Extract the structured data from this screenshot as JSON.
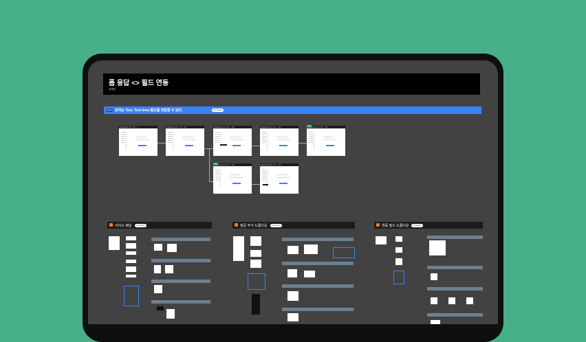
{
  "page": {
    "title": "폼 응답 <> 필드 연동",
    "author": "김태현"
  },
  "banner": {
    "tag": "Done",
    "text": "유저는 Text, Text Area 필드를 연동할 수 있다.",
    "chip": "Complete"
  },
  "frames": [
    {
      "label": "MacBook Pro 14\" - 1"
    },
    {
      "label": "MacBook Pro 14\" - 11"
    },
    {
      "label": "MacBook Pro 14\" - 29"
    },
    {
      "label": "MacBook Pro 14\" - 31"
    },
    {
      "label": "MacBook Pro 14\" - 32",
      "badge": "v1"
    },
    {
      "label": "MacBook Pro 14\" - 30",
      "badge": "v1"
    },
    {
      "label": "MacBook Pro 14\" - 33"
    }
  ],
  "sections": [
    {
      "title": "사이드 패널",
      "chip": "Complete"
    },
    {
      "title": "질문 추가 드롭다운",
      "chip": "Complete"
    },
    {
      "title": "연동 필드 드롭다운",
      "chip": "Complete"
    }
  ]
}
